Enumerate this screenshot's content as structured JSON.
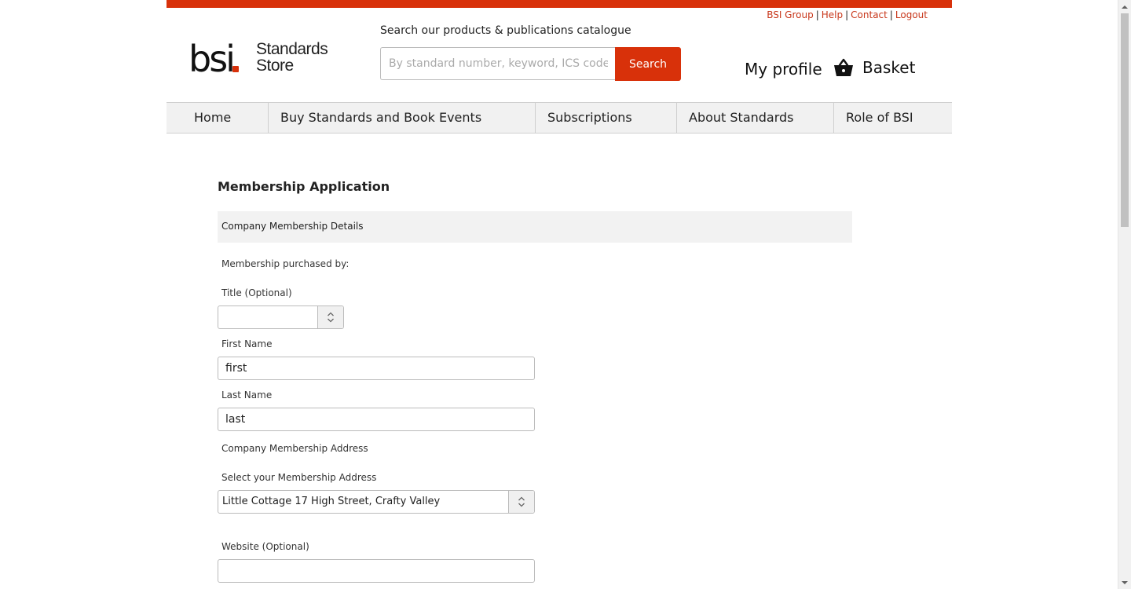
{
  "header": {
    "util_links": {
      "bsi_group": "BSI Group",
      "help": "Help",
      "contact": "Contact",
      "logout": "Logout",
      "separator": "|"
    },
    "logo": {
      "bsi": "bsi",
      "store_line1": "Standards",
      "store_line2": "Store"
    },
    "search": {
      "label": "Search our products & publications catalogue",
      "placeholder": "By standard number, keyword, ICS code, ISBN",
      "button": "Search"
    },
    "my_profile": "My profile",
    "basket": "Basket"
  },
  "nav": {
    "items": [
      {
        "label": "Home"
      },
      {
        "label": "Buy Standards and Book Events"
      },
      {
        "label": "Subscriptions"
      },
      {
        "label": "About Standards"
      },
      {
        "label": "Role of BSI"
      }
    ]
  },
  "form": {
    "page_title": "Membership Application",
    "section_title": "Company Membership Details",
    "purchased_by_label": "Membership purchased by:",
    "title_label": "Title (Optional)",
    "title_value": "",
    "first_name_label": "First Name",
    "first_name_value": "first",
    "last_name_label": "Last Name",
    "last_name_value": "last",
    "address_section_label": "Company Membership Address",
    "select_address_label": "Select your Membership Address",
    "select_address_value": "Little Cottage 17 High Street, Crafty Valley",
    "website_label": "Website (Optional)",
    "website_value": ""
  },
  "colors": {
    "brand": "#d8310a",
    "link": "#c8371b",
    "nav_bg": "#f1f1f1",
    "section_bg": "#f2f2f2"
  }
}
